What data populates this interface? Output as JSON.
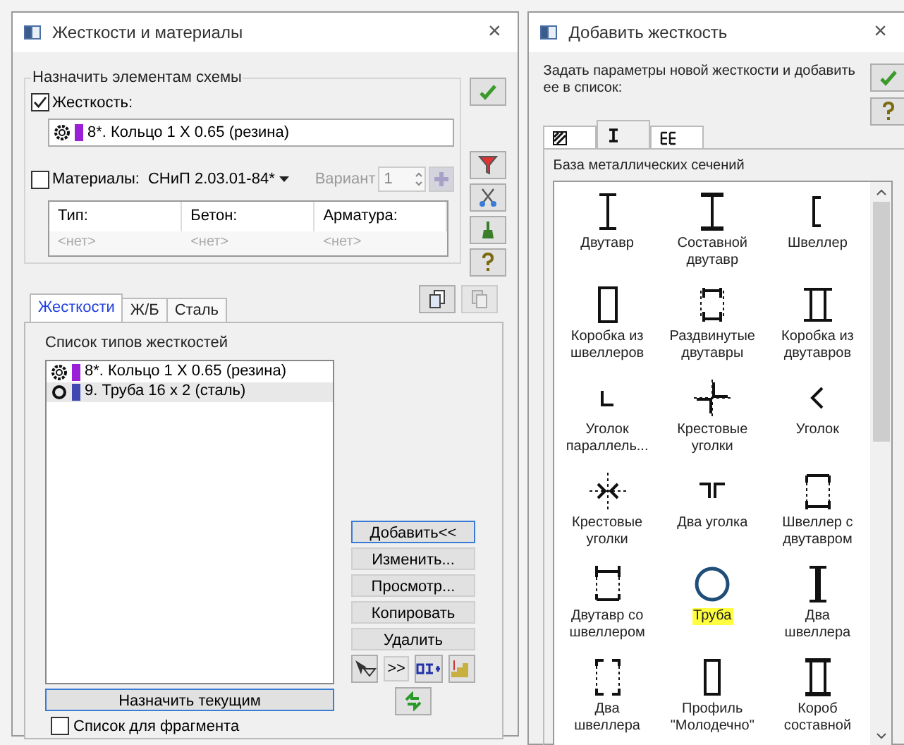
{
  "left_window": {
    "title": "Жесткости и материалы",
    "close": "×",
    "assign_group": {
      "legend": "Назначить элементам схемы",
      "stiffness": {
        "label": "Жесткость:",
        "checked": true,
        "value": "8*. Кольцо 1 X 0.65 (резина)",
        "kind": "ring",
        "color": "#9b1fd6"
      },
      "materials": {
        "label": "Материалы:",
        "checked": false,
        "norm": "СНиП 2.03.01-84*",
        "variant_label": "Вариант",
        "variant_value": "1",
        "disabled": true
      },
      "table": {
        "columns": [
          "Тип:",
          "Бетон:",
          "Арматура:"
        ],
        "row": [
          "<нет>",
          "<нет>",
          "<нет>"
        ]
      }
    },
    "tabs": [
      {
        "label": "Жесткости",
        "selected": true
      },
      {
        "label": "Ж/Б",
        "selected": false
      },
      {
        "label": "Сталь",
        "selected": false
      }
    ],
    "list_title": "Список типов жесткостей",
    "list_items": [
      {
        "text": "8*. Кольцо 1 X 0.65 (резина)",
        "kind": "ring",
        "color": "#9b1fd6",
        "selected": false
      },
      {
        "text": "9. Труба 16 x 2 (сталь)",
        "kind": "pipe",
        "color": "#3f48b0",
        "selected": true
      }
    ],
    "buttons": [
      {
        "label": "Добавить<<",
        "default": true
      },
      {
        "label": "Изменить...",
        "default": false
      },
      {
        "label": "Просмотр...",
        "default": false
      },
      {
        "label": "Копировать",
        "default": false
      },
      {
        "label": "Удалить",
        "default": false
      }
    ],
    "more_button": ">>",
    "assign_button": "Назначить текущим",
    "fragment": {
      "label": "Список для фрагмента",
      "checked": false
    }
  },
  "right_window": {
    "title": "Добавить жесткость",
    "close": "×",
    "prompt": "Задать параметры новой жесткости и добавить ее в список:",
    "tabs": [
      {
        "kind": "hatch",
        "selected": false
      },
      {
        "kind": "ibeam",
        "selected": true
      },
      {
        "kind": "table",
        "selected": false
      }
    ],
    "group_label": "База металлических сечений",
    "sections": [
      {
        "kind": "i_beam",
        "label": "Двутавр",
        "highlighted": false
      },
      {
        "kind": "built_i_beam",
        "label": "Составной двутавр",
        "highlighted": false
      },
      {
        "kind": "channel",
        "label": "Швеллер",
        "highlighted": false
      },
      {
        "kind": "channel_box",
        "label": "Коробка из швеллеров",
        "highlighted": false
      },
      {
        "kind": "spread_i_beams",
        "label": "Раздвинутые двутавры",
        "highlighted": false
      },
      {
        "kind": "i_beam_box",
        "label": "Коробка из двутавров",
        "highlighted": false
      },
      {
        "kind": "angle",
        "label": "Уголок параллель...",
        "highlighted": false
      },
      {
        "kind": "cross_angles",
        "label": "Крестовые уголки",
        "highlighted": false
      },
      {
        "kind": "angle_lt",
        "label": "Уголок",
        "highlighted": false
      },
      {
        "kind": "cross_angles_2",
        "label": "Крестовые уголки",
        "highlighted": false
      },
      {
        "kind": "two_angles",
        "label": "Два уголка",
        "highlighted": false
      },
      {
        "kind": "channel_i_beam",
        "label": "Швеллер с двутавром",
        "highlighted": false
      },
      {
        "kind": "i_beam_channel",
        "label": "Двутавр со швеллером",
        "highlighted": false
      },
      {
        "kind": "pipe",
        "label": "Труба",
        "highlighted": true
      },
      {
        "kind": "two_channels",
        "label": "Два швеллера",
        "highlighted": false
      },
      {
        "kind": "two_channels_box",
        "label": "Два швеллера",
        "highlighted": false
      },
      {
        "kind": "molodechno",
        "label": "Профиль \"Молодечно\"",
        "highlighted": false
      },
      {
        "kind": "built_box",
        "label": "Короб составной",
        "highlighted": false
      }
    ]
  }
}
